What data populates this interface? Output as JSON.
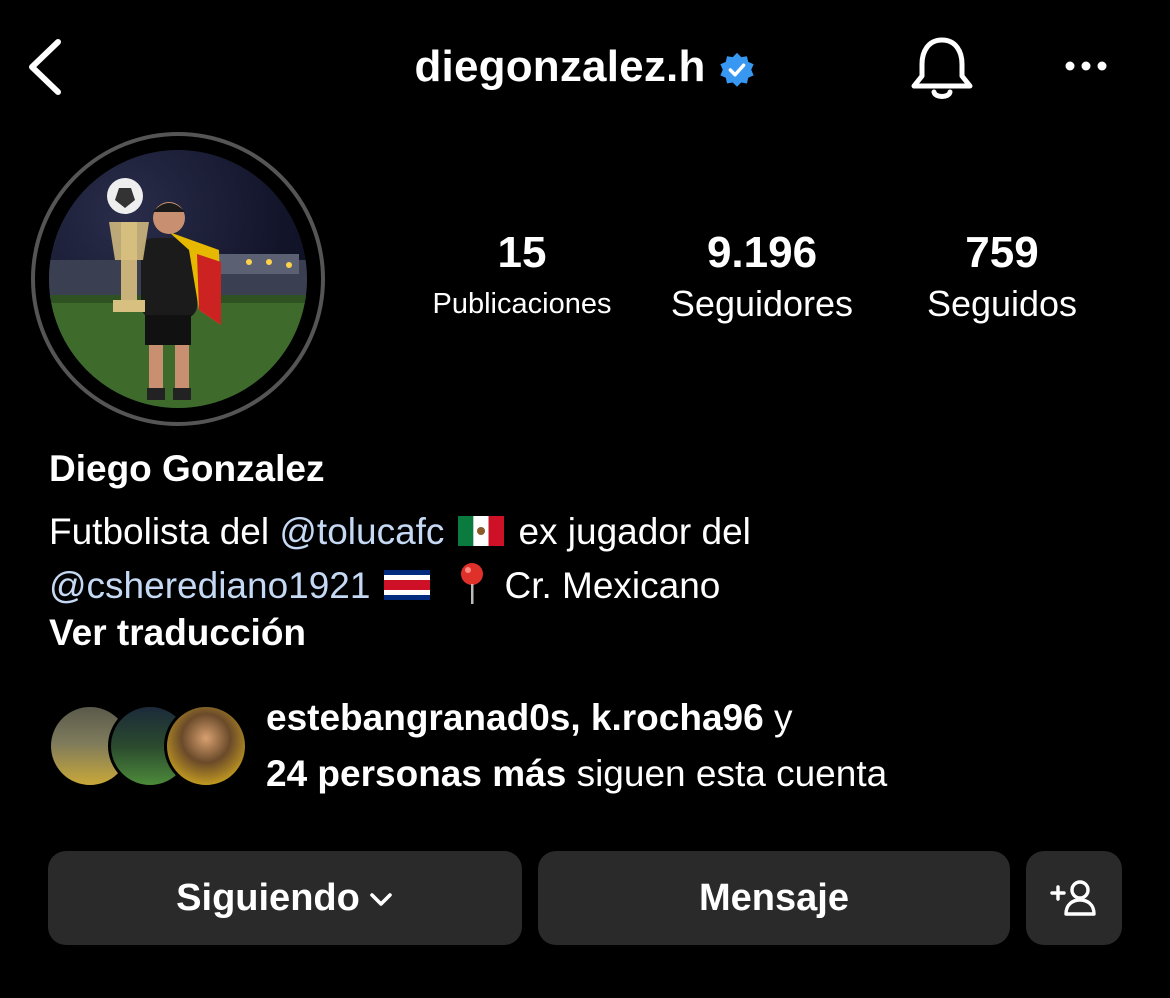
{
  "header": {
    "username": "diegonzalez.h",
    "verified": true,
    "icons": [
      "back-chevron-icon",
      "verified-badge-icon",
      "notification-bell-icon",
      "more-options-icon"
    ]
  },
  "stats": {
    "posts": {
      "value": "15",
      "label": "Publicaciones"
    },
    "followers": {
      "value": "9.196",
      "label": "Seguidores"
    },
    "following": {
      "value": "759",
      "label": "Seguidos"
    }
  },
  "bio": {
    "name": "Diego Gonzalez",
    "line1_prefix": "Futbolista del ",
    "mention1": "@tolucafc",
    "line1_suffix": "ex jugador del",
    "mention2": "@csherediano1921",
    "line2_suffix": "Cr. Mexicano",
    "translate_label": "Ver traducción"
  },
  "followed_by": {
    "users": "estebangranad0s, k.rocha96",
    "connector": " y",
    "others": "24 personas más",
    "suffix": " siguen esta cuenta"
  },
  "actions": {
    "following_label": "Siguiendo",
    "message_label": "Mensaje"
  },
  "colors": {
    "background": "#000000",
    "button_bg": "#2a2a2a",
    "mention": "#c5d9f4",
    "verified": "#3897f0"
  }
}
